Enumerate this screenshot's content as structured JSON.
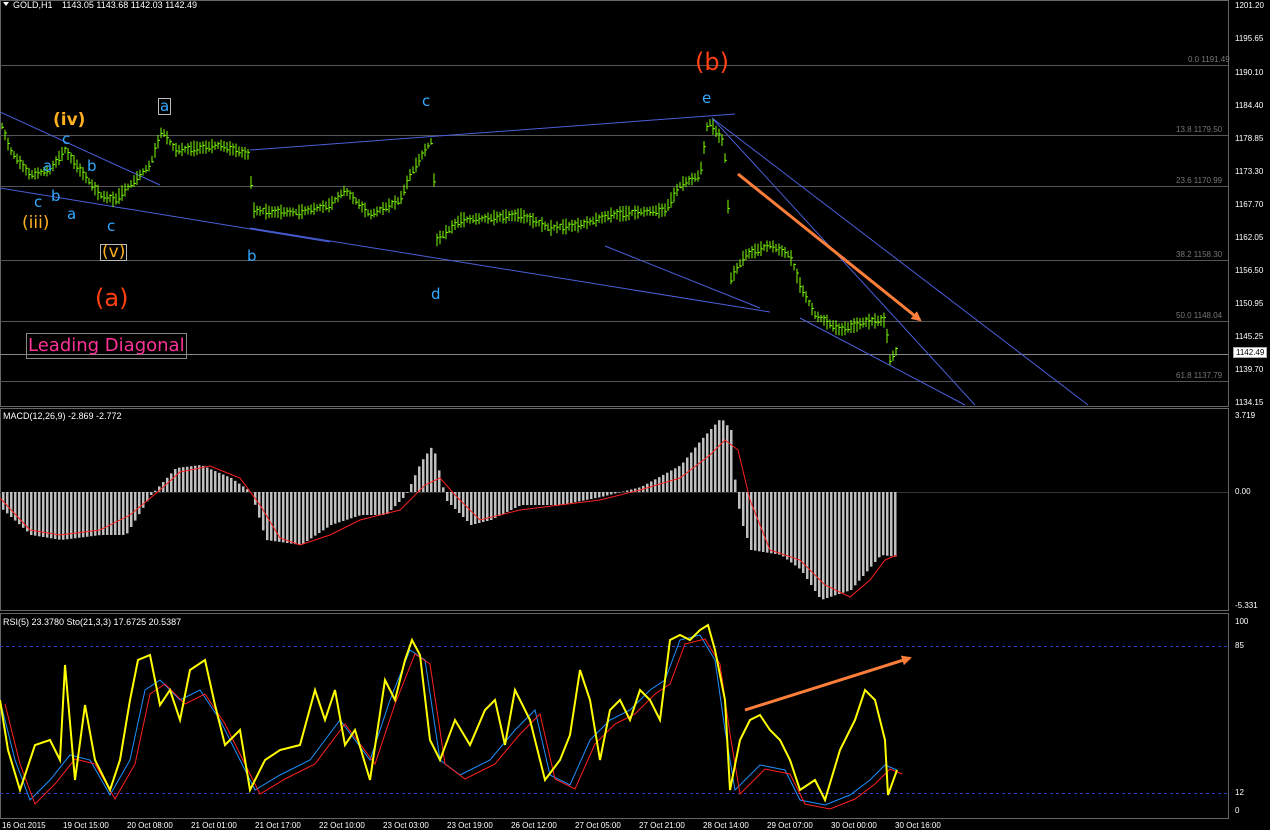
{
  "header": {
    "symbol": "GOLD,H1",
    "ohlc": "1143.05 1143.68 1142.03 1142.49",
    "macd_label": "MACD(12,26,9) -2.869 -2.772",
    "rsi_label": "RSI(5) 23.3780  Sto(21,3,3) 17.6725 20.5387"
  },
  "price_scale": [
    "1201.20",
    "1195.65",
    "1190.10",
    "1184.40",
    "1178.85",
    "1173.30",
    "1167.70",
    "1162.05",
    "1156.50",
    "1150.95",
    "1145.25",
    "1139.70",
    "1134.15"
  ],
  "current_price": "1142.49",
  "fib_levels": [
    {
      "label": "0.0 1191.49"
    },
    {
      "label": "13.8 1179.50"
    },
    {
      "label": "23.6 1170.99"
    },
    {
      "label": "38.2 1158.30"
    },
    {
      "label": "50.0 1148.04"
    },
    {
      "label": "61.8 1137.79"
    }
  ],
  "macd_scale": [
    "3.719",
    "0.00",
    "-5.331"
  ],
  "rsi_scale": [
    "100",
    "85",
    "12",
    "0"
  ],
  "wave_labels": {
    "b_big": "(b)",
    "a_big": "(a)",
    "iv": "(iv)",
    "iii": "(iii)",
    "v": "(v)",
    "leading": "Leading Diagonal",
    "blue_a_top": "a",
    "blue_c1": "c",
    "blue_a1": "a",
    "blue_b1": "b",
    "blue_b2": "b",
    "blue_c2": "c",
    "blue_a2": "a",
    "blue_c3": "c",
    "blue_b3": "b",
    "blue_c4": "c",
    "blue_d": "d",
    "blue_e": "e"
  },
  "time_labels": [
    "16 Oct 2015",
    "19 Oct 15:00",
    "20 Oct 08:00",
    "21 Oct 01:00",
    "21 Oct 17:00",
    "22 Oct 10:00",
    "23 Oct 03:00",
    "23 Oct 19:00",
    "26 Oct 12:00",
    "27 Oct 05:00",
    "27 Oct 21:00",
    "28 Oct 14:00",
    "29 Oct 07:00",
    "30 Oct 00:00",
    "30 Oct 16:00"
  ],
  "colors": {
    "background": "#000000",
    "price": "#7fff00",
    "trendline": "#4a5fd8",
    "macd_hist": "#c0c0c0",
    "macd_signal": "#ff2020",
    "rsi": "#ffff00",
    "stoch_main": "#1e90ff",
    "stoch_signal": "#ff2020",
    "arrow": "#ff7f3a",
    "wave_blue": "#33aaff",
    "wave_orange": "#ffb020",
    "wave_red": "#ff4010"
  }
}
